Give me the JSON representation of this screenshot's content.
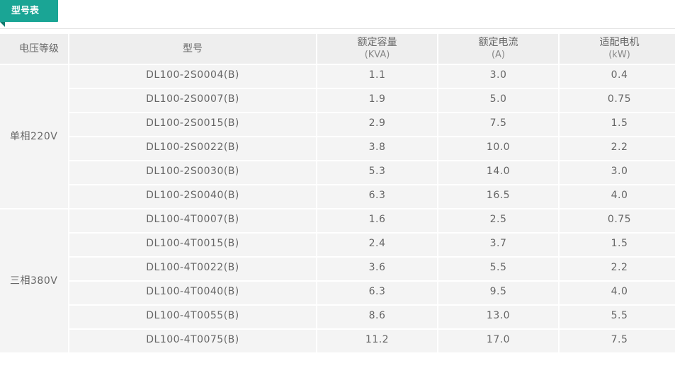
{
  "tag": {
    "label": "型号表"
  },
  "table": {
    "headers": [
      {
        "line1": "电压等级",
        "line2": ""
      },
      {
        "line1": "型号",
        "line2": ""
      },
      {
        "line1": "额定容量",
        "line2": "(KVA)"
      },
      {
        "line1": "额定电流",
        "line2": "(A)"
      },
      {
        "line1": "适配电机",
        "line2": "(kW)"
      }
    ],
    "groups": [
      {
        "label": "单相220V",
        "rows": [
          [
            "DL100-2S0004(B)",
            "1.1",
            "3.0",
            "0.4"
          ],
          [
            "DL100-2S0007(B)",
            "1.9",
            "5.0",
            "0.75"
          ],
          [
            "DL100-2S0015(B)",
            "2.9",
            "7.5",
            "1.5"
          ],
          [
            "DL100-2S0022(B)",
            "3.8",
            "10.0",
            "2.2"
          ],
          [
            "DL100-2S0030(B)",
            "5.3",
            "14.0",
            "3.0"
          ],
          [
            "DL100-2S0040(B)",
            "6.3",
            "16.5",
            "4.0"
          ]
        ]
      },
      {
        "label": "三相380V",
        "rows": [
          [
            "DL100-4T0007(B)",
            "1.6",
            "2.5",
            "0.75"
          ],
          [
            "DL100-4T0015(B)",
            "2.4",
            "3.7",
            "1.5"
          ],
          [
            "DL100-4T0022(B)",
            "3.6",
            "5.5",
            "2.2"
          ],
          [
            "DL100-4T0040(B)",
            "6.3",
            "9.5",
            "4.0"
          ],
          [
            "DL100-4T0055(B)",
            "8.6",
            "13.0",
            "5.5"
          ],
          [
            "DL100-4T0075(B)",
            "11.2",
            "17.0",
            "7.5"
          ]
        ]
      }
    ]
  }
}
